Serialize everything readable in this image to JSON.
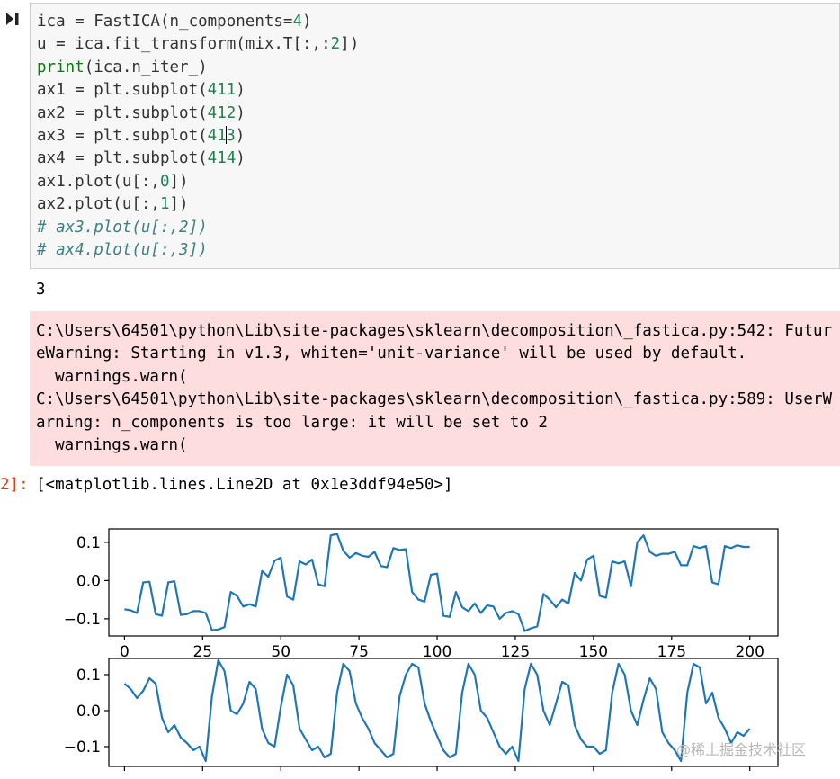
{
  "code_cell": {
    "lines": [
      [
        {
          "t": "ica = FastICA(n_components="
        },
        {
          "t": "4",
          "c": "num"
        },
        {
          "t": ")"
        }
      ],
      [
        {
          "t": "u = ica.fit_transform(mix.T[:,:"
        },
        {
          "t": "2",
          "c": "num"
        },
        {
          "t": "])"
        }
      ],
      [
        {
          "t": "print",
          "c": "kw"
        },
        {
          "t": "(ica.n_iter_)"
        }
      ],
      [
        {
          "t": "ax1 = plt.subplot("
        },
        {
          "t": "411",
          "c": "num"
        },
        {
          "t": ")"
        }
      ],
      [
        {
          "t": "ax2 = plt.subplot("
        },
        {
          "t": "412",
          "c": "num"
        },
        {
          "t": ")"
        }
      ],
      [
        {
          "t": "ax3 = plt.subplot("
        },
        {
          "t": "41",
          "c": "num"
        },
        {
          "t": "",
          "c": "cursor"
        },
        {
          "t": "3",
          "c": "num"
        },
        {
          "t": ")"
        }
      ],
      [
        {
          "t": "ax4 = plt.subplot("
        },
        {
          "t": "414",
          "c": "num"
        },
        {
          "t": ")"
        }
      ],
      [
        {
          "t": "ax1.plot(u[:,"
        },
        {
          "t": "0",
          "c": "num"
        },
        {
          "t": "])"
        }
      ],
      [
        {
          "t": "ax2.plot(u[:,"
        },
        {
          "t": "1",
          "c": "num"
        },
        {
          "t": "])"
        }
      ],
      [
        {
          "t": "# ax3.plot(u[:,2])",
          "c": "cmt"
        }
      ],
      [
        {
          "t": "# ax4.plot(u[:,3])",
          "c": "cmt"
        }
      ]
    ]
  },
  "output": {
    "stdout": "3",
    "stderr_lines": [
      "C:\\Users\\64501\\python\\Lib\\site-packages\\sklearn\\decomposition\\_fastica.py:542: Futur",
      "eWarning: Starting in v1.3, whiten='unit-variance' will be used by default.",
      "  warnings.warn(",
      "C:\\Users\\64501\\python\\Lib\\site-packages\\sklearn\\decomposition\\_fastica.py:589: UserW",
      "arning: n_components is too large: it will be set to 2",
      "  warnings.warn("
    ],
    "prompt": "2]:",
    "result_repr": "[<matplotlib.lines.Line2D at 0x1e3ddf94e50>]"
  },
  "chart_data": [
    {
      "type": "line",
      "title": "",
      "xlabel": "",
      "ylabel": "",
      "xlim": [
        -5,
        209
      ],
      "ylim": [
        -0.145,
        0.135
      ],
      "xticks": [
        0,
        25,
        50,
        75,
        100,
        125,
        150,
        175,
        200
      ],
      "xtick_labels": [
        "0",
        "25",
        "50",
        "75",
        "100",
        "125",
        "150",
        "175",
        "200"
      ],
      "yticks": [
        0.1,
        0.0,
        -0.1
      ],
      "ytick_labels": [
        "0.1",
        "0.0",
        "−0.1"
      ],
      "color": "#1f77b4",
      "series": [
        {
          "x": [
            0,
            2,
            4,
            6,
            8,
            10,
            12,
            14,
            16,
            18,
            20,
            22,
            24,
            26,
            28,
            30,
            32,
            34,
            36,
            38,
            40,
            42,
            44,
            46,
            48,
            50,
            52,
            54,
            56,
            58,
            60,
            62,
            64,
            66,
            68,
            70,
            72,
            74,
            76,
            78,
            80,
            82,
            84,
            86,
            88,
            90,
            92,
            94,
            96,
            98,
            100,
            102,
            104,
            106,
            108,
            110,
            112,
            114,
            116,
            118,
            120,
            122,
            124,
            126,
            128,
            130,
            132,
            134,
            136,
            138,
            140,
            142,
            144,
            146,
            148,
            150,
            152,
            154,
            156,
            158,
            160,
            162,
            164,
            166,
            168,
            170,
            172,
            174,
            176,
            178,
            180,
            182,
            184,
            186,
            188,
            190,
            192,
            194,
            196,
            198,
            200
          ],
          "y": [
            -0.075,
            -0.078,
            -0.085,
            -0.005,
            -0.003,
            -0.088,
            -0.092,
            -0.005,
            -0.002,
            -0.09,
            -0.088,
            -0.08,
            -0.08,
            -0.085,
            -0.13,
            -0.128,
            -0.122,
            -0.03,
            -0.04,
            -0.068,
            -0.062,
            -0.068,
            0.025,
            0.01,
            0.052,
            0.06,
            -0.042,
            -0.05,
            0.05,
            0.042,
            0.055,
            -0.01,
            -0.015,
            0.118,
            0.122,
            0.078,
            0.06,
            0.072,
            0.065,
            0.062,
            0.075,
            0.038,
            0.035,
            0.085,
            0.08,
            0.082,
            -0.03,
            -0.05,
            -0.055,
            0.015,
            0.018,
            -0.092,
            -0.095,
            -0.03,
            -0.07,
            -0.08,
            -0.06,
            -0.085,
            -0.065,
            -0.068,
            -0.1,
            -0.085,
            -0.08,
            -0.088,
            -0.132,
            -0.125,
            -0.12,
            -0.035,
            -0.05,
            -0.07,
            -0.05,
            -0.06,
            0.02,
            0.0,
            0.055,
            0.065,
            -0.04,
            -0.045,
            0.05,
            0.045,
            0.05,
            -0.015,
            0.1,
            0.118,
            0.075,
            0.065,
            0.07,
            0.07,
            0.075,
            0.04,
            0.04,
            0.09,
            0.085,
            0.09,
            -0.005,
            -0.01,
            0.09,
            0.085,
            0.092,
            0.088,
            0.088
          ]
        }
      ]
    },
    {
      "type": "line",
      "title": "",
      "xlabel": "",
      "ylabel": "",
      "xlim": [
        -5,
        209
      ],
      "ylim": [
        -0.155,
        0.145
      ],
      "xticks": [
        0,
        25,
        50,
        75,
        100,
        125,
        150,
        175,
        200
      ],
      "yticks": [
        0.1,
        0.0,
        -0.1
      ],
      "ytick_labels": [
        "0.1",
        "0.0",
        "−0.1"
      ],
      "color": "#1f77b4",
      "series": [
        {
          "x": [
            0,
            2,
            4,
            6,
            8,
            10,
            12,
            14,
            16,
            18,
            20,
            22,
            24,
            26,
            28,
            30,
            32,
            34,
            36,
            38,
            40,
            42,
            44,
            46,
            48,
            50,
            52,
            54,
            56,
            58,
            60,
            62,
            64,
            66,
            68,
            70,
            72,
            74,
            76,
            78,
            80,
            82,
            84,
            86,
            88,
            90,
            92,
            94,
            96,
            98,
            100,
            102,
            104,
            106,
            108,
            110,
            112,
            114,
            116,
            118,
            120,
            122,
            124,
            126,
            128,
            130,
            132,
            134,
            136,
            138,
            140,
            142,
            144,
            146,
            148,
            150,
            152,
            154,
            156,
            158,
            160,
            162,
            164,
            166,
            168,
            170,
            172,
            174,
            176,
            178,
            180,
            182,
            184,
            186,
            188,
            190,
            192,
            194,
            196,
            198,
            200
          ],
          "y": [
            0.075,
            0.06,
            0.035,
            0.055,
            0.09,
            0.075,
            -0.02,
            -0.06,
            -0.04,
            -0.075,
            -0.09,
            -0.11,
            -0.1,
            -0.14,
            0.04,
            0.14,
            0.11,
            0.0,
            -0.01,
            0.02,
            0.08,
            0.06,
            -0.05,
            -0.09,
            -0.1,
            0.01,
            0.1,
            0.07,
            -0.05,
            -0.08,
            -0.11,
            -0.1,
            -0.13,
            -0.12,
            0.05,
            0.13,
            0.11,
            0.02,
            -0.02,
            -0.05,
            -0.09,
            -0.11,
            -0.13,
            -0.12,
            0.04,
            0.1,
            0.13,
            0.12,
            0.02,
            -0.03,
            -0.07,
            -0.11,
            -0.13,
            -0.12,
            0.05,
            0.13,
            0.1,
            0.0,
            -0.02,
            -0.06,
            -0.1,
            -0.12,
            -0.1,
            -0.14,
            0.06,
            0.13,
            0.1,
            0.0,
            -0.04,
            0.02,
            0.08,
            0.07,
            -0.04,
            -0.08,
            -0.1,
            -0.1,
            -0.12,
            -0.11,
            0.05,
            0.13,
            0.1,
            0.0,
            -0.04,
            0.03,
            0.09,
            0.06,
            -0.06,
            -0.09,
            -0.11,
            -0.14,
            0.05,
            0.13,
            0.12,
            0.02,
            0.05,
            -0.02,
            -0.05,
            -0.09,
            -0.06,
            -0.07,
            -0.05
          ]
        }
      ]
    }
  ],
  "watermark": "@稀土掘金技术社区",
  "colors": {
    "code_bg": "#f7f7f7",
    "stderr_bg": "#fddddd",
    "line": "#1f77b4",
    "prompt": "#d84315"
  }
}
